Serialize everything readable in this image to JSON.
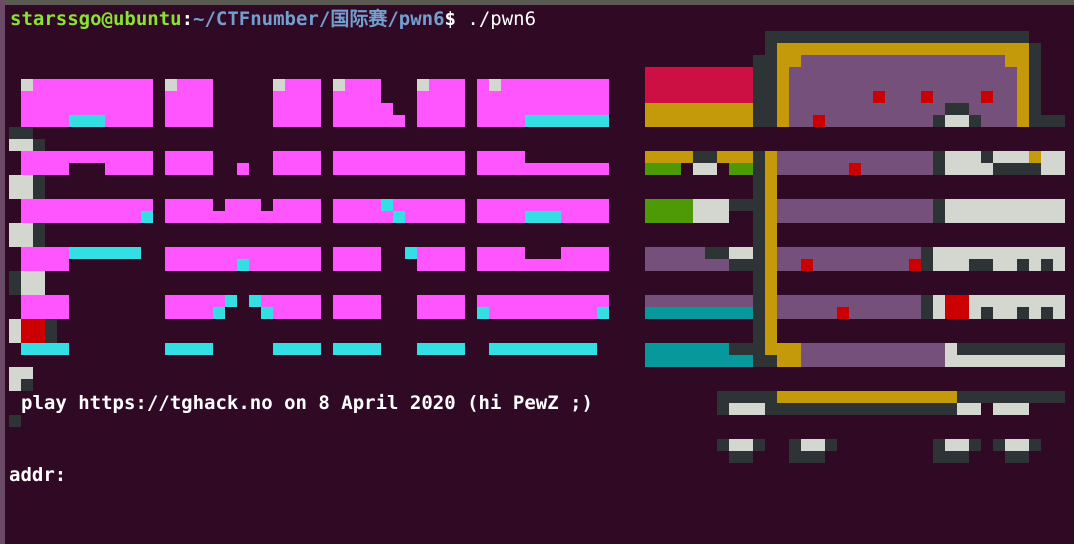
{
  "terminal": {
    "prompt_user": "starssgo@ubuntu",
    "prompt_sep": ":",
    "prompt_path": "~/CTFnumber/国际赛/pwn6",
    "prompt_symbol": "$",
    "command": " ./pwn6",
    "banner_text": "play https://tghack.no on 8 April 2020 (hi PewZ ;)",
    "input_prompt": "addr:"
  },
  "art": {
    "logo_letters": [
      "T",
      "G",
      "H",
      "A",
      "C",
      "K"
    ],
    "mascot": "nyan-cat",
    "colors": {
      "magenta": "#ff55ff",
      "cyan": "#33dfe3",
      "red": "#cc1044",
      "orange": "#c49a0a",
      "green": "#4e9a06",
      "teal": "#06989a",
      "purple": "#75507b",
      "dark": "#2e3436",
      "light": "#d3d7cf"
    }
  }
}
